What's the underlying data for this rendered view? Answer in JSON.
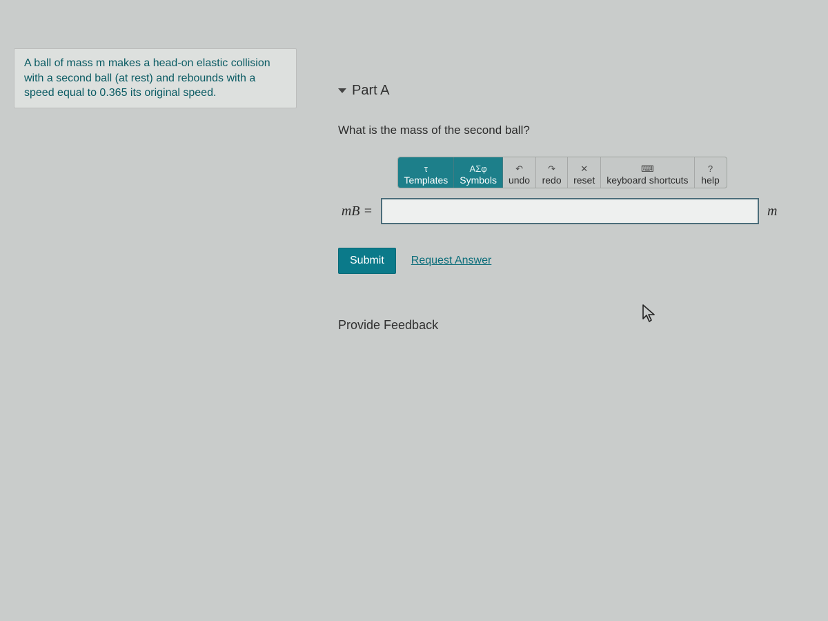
{
  "problem": {
    "text": "A ball of mass m makes a head-on elastic collision with a second ball (at rest) and rebounds with a speed equal to 0.365 its original speed."
  },
  "part": {
    "label": "Part A",
    "question": "What is the mass of the second ball?"
  },
  "toolbar": {
    "templates": "Templates",
    "symbols": "Symbols",
    "undo": "undo",
    "redo": "redo",
    "reset": "reset",
    "keyboard": "keyboard shortcuts",
    "help": "help"
  },
  "input": {
    "lhs": "mB =",
    "value": "",
    "unit": "m"
  },
  "actions": {
    "submit": "Submit",
    "request": "Request Answer"
  },
  "feedback": {
    "label": "Provide Feedback"
  }
}
